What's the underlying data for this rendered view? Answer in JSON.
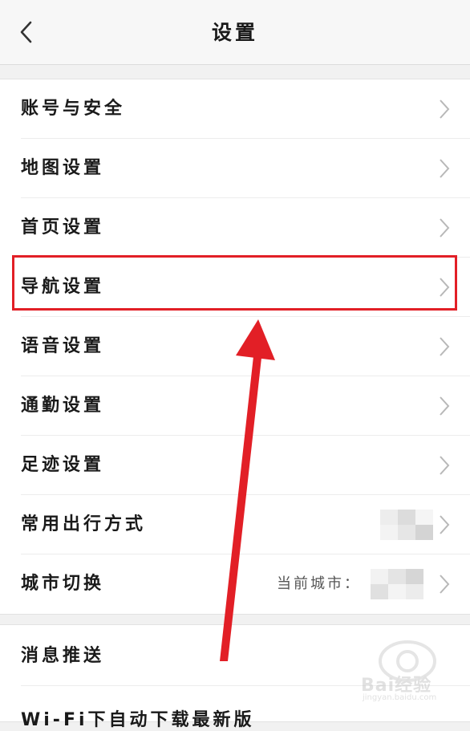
{
  "header": {
    "title": "设置"
  },
  "group1": [
    {
      "label": "账号与安全"
    },
    {
      "label": "地图设置"
    },
    {
      "label": "首页设置"
    },
    {
      "label": "导航设置"
    },
    {
      "label": "语音设置"
    },
    {
      "label": "通勤设置"
    },
    {
      "label": "足迹设置"
    },
    {
      "label": "常用出行方式"
    },
    {
      "label": "城市切换",
      "value": "当前城市："
    }
  ],
  "group2": [
    {
      "label": "消息推送"
    },
    {
      "label": "Wi-Fi下自动下载最新版"
    }
  ],
  "annotation": {
    "highlighted_item": "导航设置",
    "color": "#e21f26"
  },
  "watermark": {
    "text": "Bai经验",
    "sub": "jingyan.baidu.com"
  },
  "icons": {
    "back": "chevron-left-icon",
    "row": "chevron-right-icon"
  }
}
